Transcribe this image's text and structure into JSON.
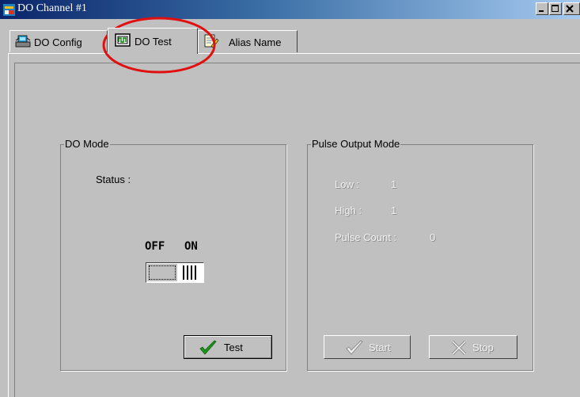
{
  "window": {
    "title": "DO Channel #1",
    "icon": "app-icon",
    "buttons": [
      "minimize-icon",
      "maximize-icon",
      "close-icon"
    ],
    "title_gradient": [
      "#0a246a",
      "#a6caf0"
    ]
  },
  "tabs": [
    {
      "label": "DO Config",
      "icon": "network-computer-icon",
      "active": false
    },
    {
      "label": "DO Test",
      "icon": "chip-test-icon",
      "active": true
    },
    {
      "label": "Alias Name",
      "icon": "notepad-pencil-icon",
      "active": false
    }
  ],
  "annotation": {
    "color": "#e01010",
    "shape": "ellipse-around-active-tab"
  },
  "do_mode": {
    "title": "DO Mode",
    "status_label": "Status :",
    "switch": {
      "off_label": "OFF",
      "on_label": "ON",
      "state": "OFF"
    },
    "test_button": {
      "label": "Test",
      "icon": "checkmark-icon"
    }
  },
  "pulse_mode": {
    "title": "Pulse Output Mode",
    "enabled": false,
    "low": {
      "label": "Low :",
      "value": "1"
    },
    "high": {
      "label": "High :",
      "value": "1"
    },
    "pulse_count": {
      "label": "Pulse Count :",
      "value": "0"
    },
    "start_button": {
      "label": "Start",
      "icon": "checkmark-icon"
    },
    "stop_button": {
      "label": "Stop",
      "icon": "cross-icon"
    }
  }
}
